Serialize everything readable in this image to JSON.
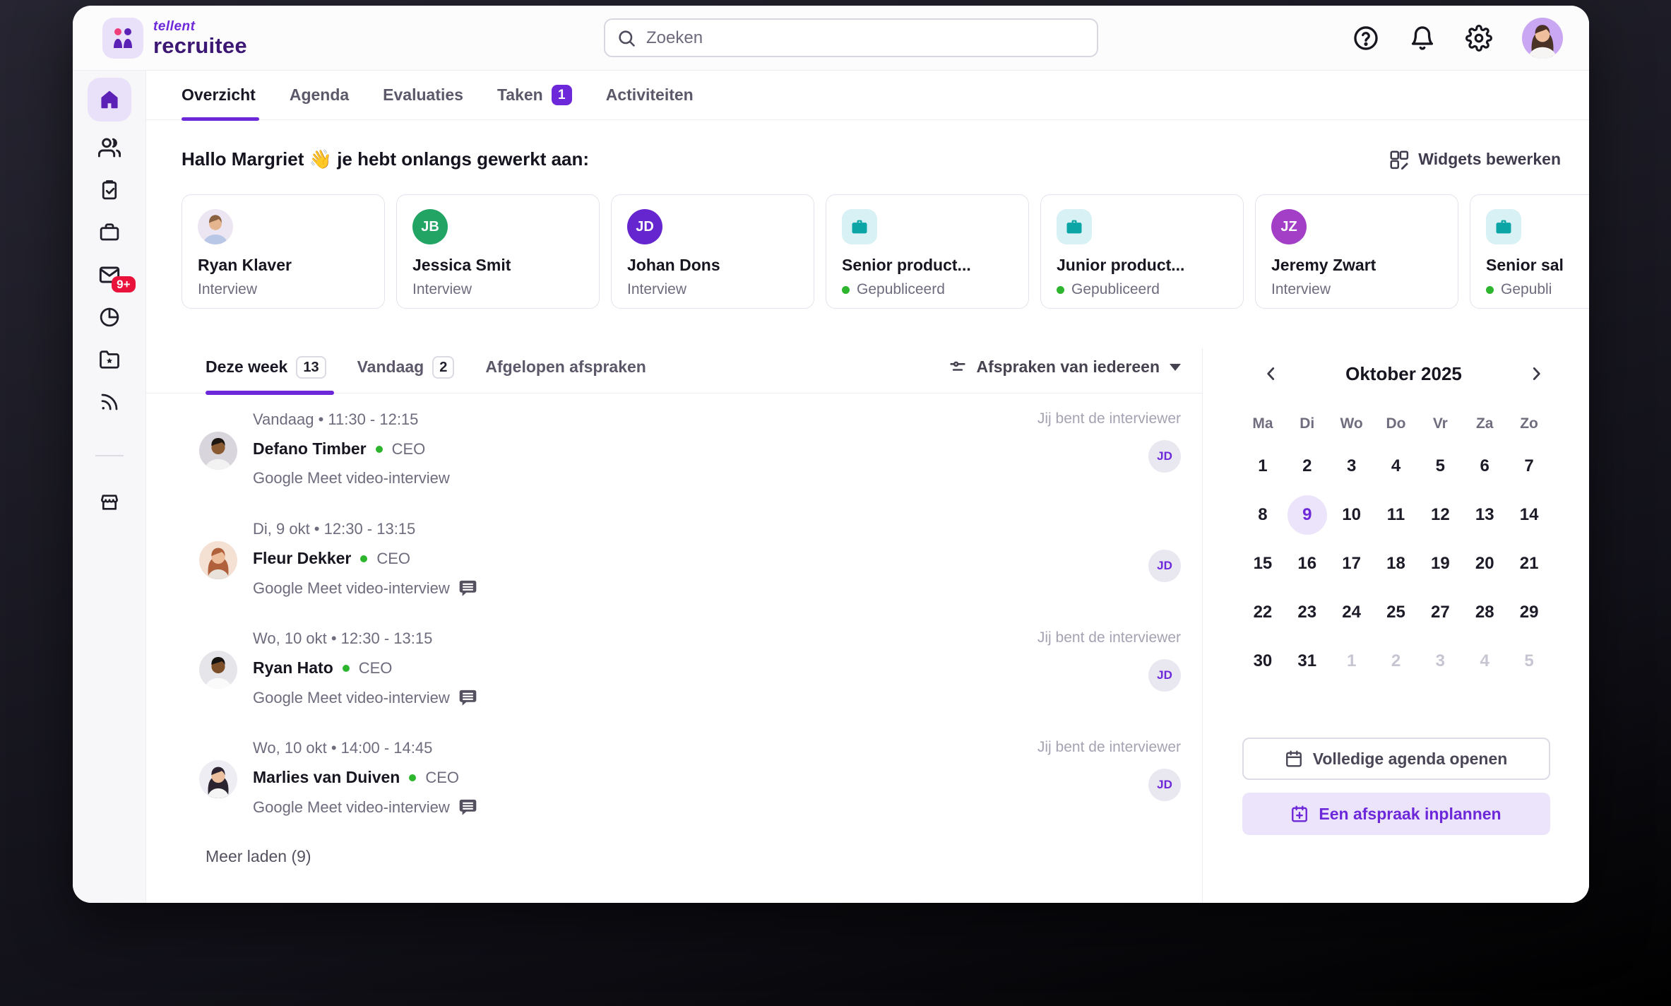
{
  "brand": {
    "name_top": "tellent",
    "name_bottom": "recruitee"
  },
  "topbar": {
    "search_placeholder": "Zoeken",
    "icons": [
      "help-icon",
      "notifications-icon",
      "settings-icon",
      "user-avatar"
    ]
  },
  "nav_tabs": [
    {
      "label": "Overzicht",
      "active": true
    },
    {
      "label": "Agenda"
    },
    {
      "label": "Evaluaties"
    },
    {
      "label": "Taken",
      "badge": "1"
    },
    {
      "label": "Activiteiten"
    }
  ],
  "sidebar": {
    "inbox_badge": "9+",
    "items": [
      "home",
      "candidates",
      "evaluations",
      "jobs",
      "inbox",
      "reports",
      "talent-pool",
      "sourcing",
      "marketplace"
    ]
  },
  "greeting": {
    "title": "Hallo Margriet 👋 je hebt onlangs gewerkt aan:",
    "edit_widgets_label": "Widgets bewerken"
  },
  "recent_items": [
    {
      "name": "Ryan Klaver",
      "status": "Interview",
      "kind": "candidate-photo"
    },
    {
      "name": "Jessica Smit",
      "status": "Interview",
      "kind": "candidate-initials",
      "initials": "JB",
      "color": "#21a464"
    },
    {
      "name": "Johan Dons",
      "status": "Interview",
      "kind": "candidate-initials",
      "initials": "JD",
      "color": "#6526cf"
    },
    {
      "name": "Senior product...",
      "status": "Gepubliceerd",
      "kind": "job"
    },
    {
      "name": "Junior product...",
      "status": "Gepubliceerd",
      "kind": "job"
    },
    {
      "name": "Jeremy Zwart",
      "status": "Interview",
      "kind": "candidate-initials",
      "initials": "JZ",
      "color": "#a23fc6"
    },
    {
      "name": "Senior sal",
      "status": "Gepubli",
      "kind": "job"
    }
  ],
  "appointments": {
    "tabs": [
      {
        "label": "Deze week",
        "badge": "13",
        "active": true
      },
      {
        "label": "Vandaag",
        "badge": "2"
      },
      {
        "label": "Afgelopen afspraken"
      }
    ],
    "filter_label": "Afspraken van iedereen",
    "items": [
      {
        "datetime": "Vandaag • 11:30 - 12:15",
        "name": "Defano Timber",
        "role": "CEO",
        "meeting": "Google Meet video-interview",
        "note": "Jij bent de interviewer",
        "badge": "JD",
        "chat": false
      },
      {
        "datetime": "Di, 9 okt • 12:30 - 13:15",
        "name": "Fleur Dekker",
        "role": "CEO",
        "meeting": "Google Meet video-interview",
        "note": "",
        "badge": "JD",
        "chat": true
      },
      {
        "datetime": "Wo, 10 okt • 12:30 - 13:15",
        "name": "Ryan Hato",
        "role": "CEO",
        "meeting": "Google Meet video-interview",
        "note": "Jij bent de interviewer",
        "badge": "JD",
        "chat": true
      },
      {
        "datetime": "Wo, 10 okt • 14:00 - 14:45",
        "name": "Marlies van Duiven",
        "role": "CEO",
        "meeting": "Google Meet video-interview",
        "note": "Jij bent de interviewer",
        "badge": "JD",
        "chat": true
      }
    ],
    "load_more_label": "Meer laden (9)"
  },
  "calendar": {
    "month_label": "Oktober 2025",
    "weekdays": [
      "Ma",
      "Di",
      "Wo",
      "Do",
      "Vr",
      "Za",
      "Zo"
    ],
    "days": [
      {
        "label": "1"
      },
      {
        "label": "2"
      },
      {
        "label": "3"
      },
      {
        "label": "4"
      },
      {
        "label": "5"
      },
      {
        "label": "6"
      },
      {
        "label": "7"
      },
      {
        "label": "8"
      },
      {
        "label": "9",
        "selected": true
      },
      {
        "label": "10"
      },
      {
        "label": "11"
      },
      {
        "label": "12"
      },
      {
        "label": "13"
      },
      {
        "label": "14"
      },
      {
        "label": "15"
      },
      {
        "label": "16"
      },
      {
        "label": "17"
      },
      {
        "label": "18"
      },
      {
        "label": "19"
      },
      {
        "label": "20"
      },
      {
        "label": "21"
      },
      {
        "label": "22"
      },
      {
        "label": "23"
      },
      {
        "label": "24"
      },
      {
        "label": "25"
      },
      {
        "label": "27"
      },
      {
        "label": "28"
      },
      {
        "label": "29"
      },
      {
        "label": "30"
      },
      {
        "label": "31"
      },
      {
        "label": "1",
        "muted": true
      },
      {
        "label": "2",
        "muted": true
      },
      {
        "label": "3",
        "muted": true
      },
      {
        "label": "4",
        "muted": true
      },
      {
        "label": "5",
        "muted": true
      }
    ],
    "open_agenda_label": "Volledige agenda openen",
    "schedule_label": "Een afspraak inplannen"
  },
  "colors": {
    "accent": "#6d28d9",
    "accent_light": "#ece4fb",
    "badge_red": "#e9123a",
    "status_green": "#2db52d",
    "job_teal": "#0ca5a5"
  }
}
